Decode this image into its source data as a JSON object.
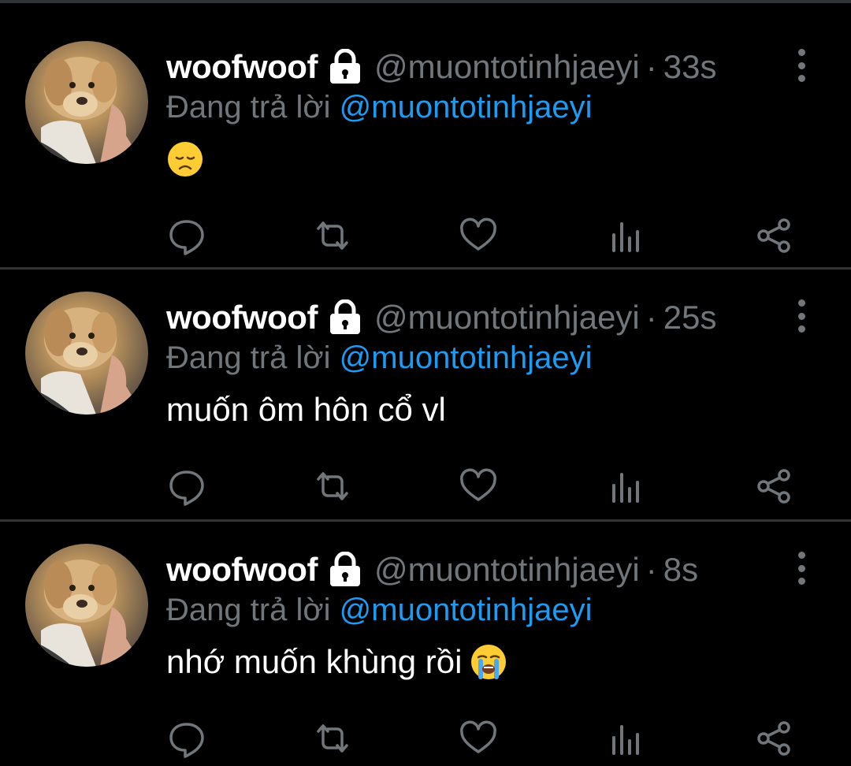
{
  "colors": {
    "background": "#000000",
    "name": "#ffffff",
    "muted": "#71767b",
    "mention": "#1d9bf0",
    "divider": "#2f3336"
  },
  "tweets": [
    {
      "display_name": "woofwoof",
      "handle": "@muontotinhjaeyi",
      "separator": "·",
      "time": "33s",
      "reply_prefix": "Đang trả lời",
      "reply_to": "@muontotinhjaeyi",
      "text": "",
      "emoji": "disappointed-face"
    },
    {
      "display_name": "woofwoof",
      "handle": "@muontotinhjaeyi",
      "separator": "·",
      "time": "25s",
      "reply_prefix": "Đang trả lời",
      "reply_to": "@muontotinhjaeyi",
      "text": "muốn ôm hôn cổ vl",
      "emoji": ""
    },
    {
      "display_name": "woofwoof",
      "handle": "@muontotinhjaeyi",
      "separator": "·",
      "time": "8s",
      "reply_prefix": "Đang trả lời",
      "reply_to": "@muontotinhjaeyi",
      "text": "nhớ muốn khùng rồi",
      "emoji": "loudly-crying-face"
    }
  ],
  "icons": {
    "reply": "reply-icon",
    "retweet": "retweet-icon",
    "like": "heart-icon",
    "views": "views-icon",
    "share": "share-icon",
    "more": "more-icon",
    "lock": "lock-icon"
  }
}
